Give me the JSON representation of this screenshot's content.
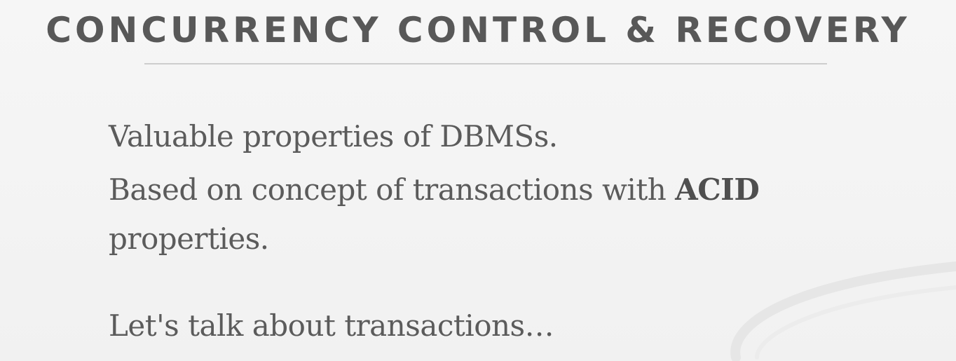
{
  "slide": {
    "title": "CONCURRENCY CONTROL & RECOVERY",
    "lines": [
      "Valuable properties of DBMSs.",
      "Based on concept of transactions with ",
      "properties.",
      "Let's talk about transactions…"
    ],
    "emphasis": "ACID"
  },
  "decor": {
    "swirl_icon": "decorative-swirl-icon"
  }
}
